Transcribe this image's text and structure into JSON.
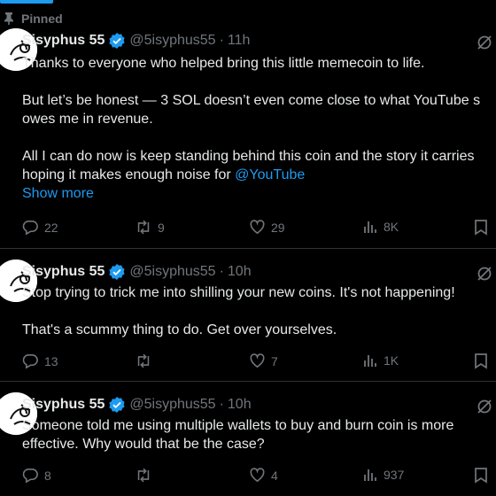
{
  "pinned_label": "Pinned",
  "tweets": [
    {
      "name": "Sisyphus 55",
      "handle": "@5isyphus55",
      "time": "11h",
      "lines": [
        "Thanks to everyone who helped bring this little memecoin to life.",
        "",
        "But let’s be honest — 3 SOL doesn’t even come close to what YouTube s",
        "owes me in revenue.",
        "",
        "All I can do now is keep standing behind this coin and the story it carries",
        "hoping it makes enough noise for "
      ],
      "mention": "@YouTube",
      "show_more": "Show more",
      "replies": "22",
      "reposts": "9",
      "likes": "29",
      "views": "8K"
    },
    {
      "name": "Sisyphus 55",
      "handle": "@5isyphus55",
      "time": "10h",
      "lines": [
        "Stop trying to trick me into shilling your new coins. It's not happening!",
        "",
        "That's a scummy thing to do. Get over yourselves."
      ],
      "replies": "13",
      "reposts": "",
      "likes": "7",
      "views": "1K"
    },
    {
      "name": "Sisyphus 55",
      "handle": "@5isyphus55",
      "time": "10h",
      "lines": [
        "Someone told me using multiple wallets to buy and burn coin is more",
        "effective. Why would that be the case?"
      ],
      "replies": "8",
      "reposts": "",
      "likes": "4",
      "views": "937"
    }
  ],
  "colors": {
    "accent": "#1d9bf0",
    "muted": "#71767b",
    "text": "#e7e9ea",
    "divider": "#2f3336"
  },
  "icons": [
    "pin-icon",
    "verified-badge-icon",
    "grok-icon",
    "reply-icon",
    "repost-icon",
    "like-icon",
    "views-icon",
    "bookmark-icon"
  ]
}
